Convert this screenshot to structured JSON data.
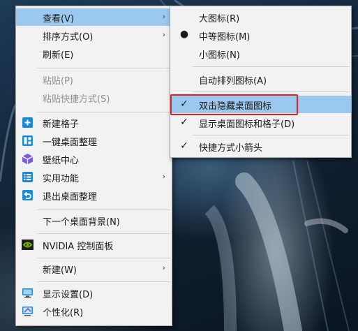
{
  "main_menu": {
    "items": [
      {
        "label": "查看(V)",
        "has_submenu": true,
        "highlighted": true
      },
      {
        "label": "排序方式(O)",
        "has_submenu": true
      },
      {
        "label": "刷新(E)"
      },
      {
        "label": "粘贴(P)",
        "disabled": true
      },
      {
        "label": "粘贴快捷方式(S)",
        "disabled": true
      },
      {
        "label": "新建格子",
        "icon": "plus-square-icon"
      },
      {
        "label": "一键桌面整理",
        "icon": "layout-grid-icon"
      },
      {
        "label": "壁纸中心",
        "icon": "cube-icon"
      },
      {
        "label": "实用功能",
        "icon": "list-icon",
        "has_submenu": true
      },
      {
        "label": "退出桌面整理",
        "icon": "undo-icon"
      },
      {
        "label": "下一个桌面背景(N)"
      },
      {
        "label": "NVIDIA 控制面板",
        "icon": "nvidia-icon"
      },
      {
        "label": "新建(W)",
        "has_submenu": true
      },
      {
        "label": "显示设置(D)",
        "icon": "monitor-icon"
      },
      {
        "label": "个性化(R)",
        "icon": "personalize-icon"
      }
    ],
    "arrow_glyph": "›"
  },
  "sub_menu": {
    "items": [
      {
        "label": "大图标(R)"
      },
      {
        "label": "中等图标(M)",
        "marker": "●"
      },
      {
        "label": "小图标(N)"
      },
      {
        "label": "自动排列图标(A)"
      },
      {
        "label": "双击隐藏桌面图标",
        "marker": "✓",
        "highlighted": true,
        "outlined": true
      },
      {
        "label": "显示桌面图标和格子(D)",
        "marker": "✓"
      },
      {
        "label": "快捷方式小箭头",
        "marker": "✓"
      }
    ]
  },
  "colors": {
    "menu_bg": "#f2f2f2",
    "highlight": "#9ac8ee",
    "outline_red": "#e0231a",
    "icon_blue": "#1a8ad8",
    "icon_purple": "#7b5ce0",
    "nvidia_green": "#76b900"
  }
}
